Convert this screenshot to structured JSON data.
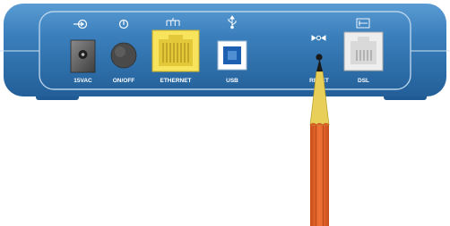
{
  "ports": {
    "power": {
      "label": "15VAC",
      "icon": "power-input-icon"
    },
    "switch": {
      "label": "ON/OFF",
      "icon": "power-toggle-icon"
    },
    "ethernet": {
      "label": "ETHERNET",
      "icon": "network-icon"
    },
    "usb": {
      "label": "USB",
      "icon": "usb-icon"
    },
    "reset": {
      "label": "RESET",
      "icon": "reset-icon"
    },
    "dsl": {
      "label": "DSL",
      "icon": "dsl-icon"
    }
  },
  "colors": {
    "panel": "#2f74ae",
    "panel_light": "#4a8ec8",
    "panel_border": "#b7d3ea",
    "ethernet_port": "#f7e45c",
    "usb_port": "#1d5fb0",
    "pencil_body": "#e2622a",
    "pencil_wood": "#e7cf5a"
  }
}
